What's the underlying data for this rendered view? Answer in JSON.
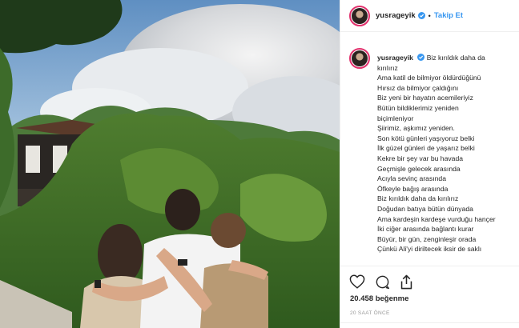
{
  "post": {
    "username": "yusrageyik",
    "follow_label": "Takip Et",
    "dot": "•",
    "caption_lines": [
      "Biz kırıldık daha da",
      "kırılırız",
      "Ama katil de bilmiyor öldürdüğünü",
      "Hırsız da bilmiyor çaldığını",
      "Biz yeni bir hayatın acemileriyiz",
      "Bütün bildiklerimiz yeniden",
      "biçimleniyor",
      "Şiirimiz, aşkımız yeniden.",
      "Son kötü günleri yaşıyoruz belki",
      "İlk güzel günleri de yaşarız belki",
      "Kekre bir şey var bu havada",
      "Geçmişle gelecek arasında",
      "Acıyla sevinç arasında",
      "Öfkeyle bağış arasında",
      "Biz kırıldık daha da kırılırız",
      "Doğudan batıya bütün dünyada",
      "Ama kardeşin kardeşe vurduğu hançer",
      "İki ciğer arasında bağlantı kurar",
      "Büyür, bir gün, zenginleşir orada",
      "Çünkü Ali'yi diriltecek iksir de saklı"
    ],
    "likes": "20.458 beğenme",
    "time_ago": "20 SAAT ÖNCE"
  },
  "icons": {
    "verified": "verified-badge-icon",
    "like": "heart-icon",
    "comment": "comment-icon",
    "share": "share-icon"
  },
  "colors": {
    "link": "#3897f0",
    "story_ring": "#e1306c",
    "text": "#262626",
    "muted": "#999999"
  }
}
